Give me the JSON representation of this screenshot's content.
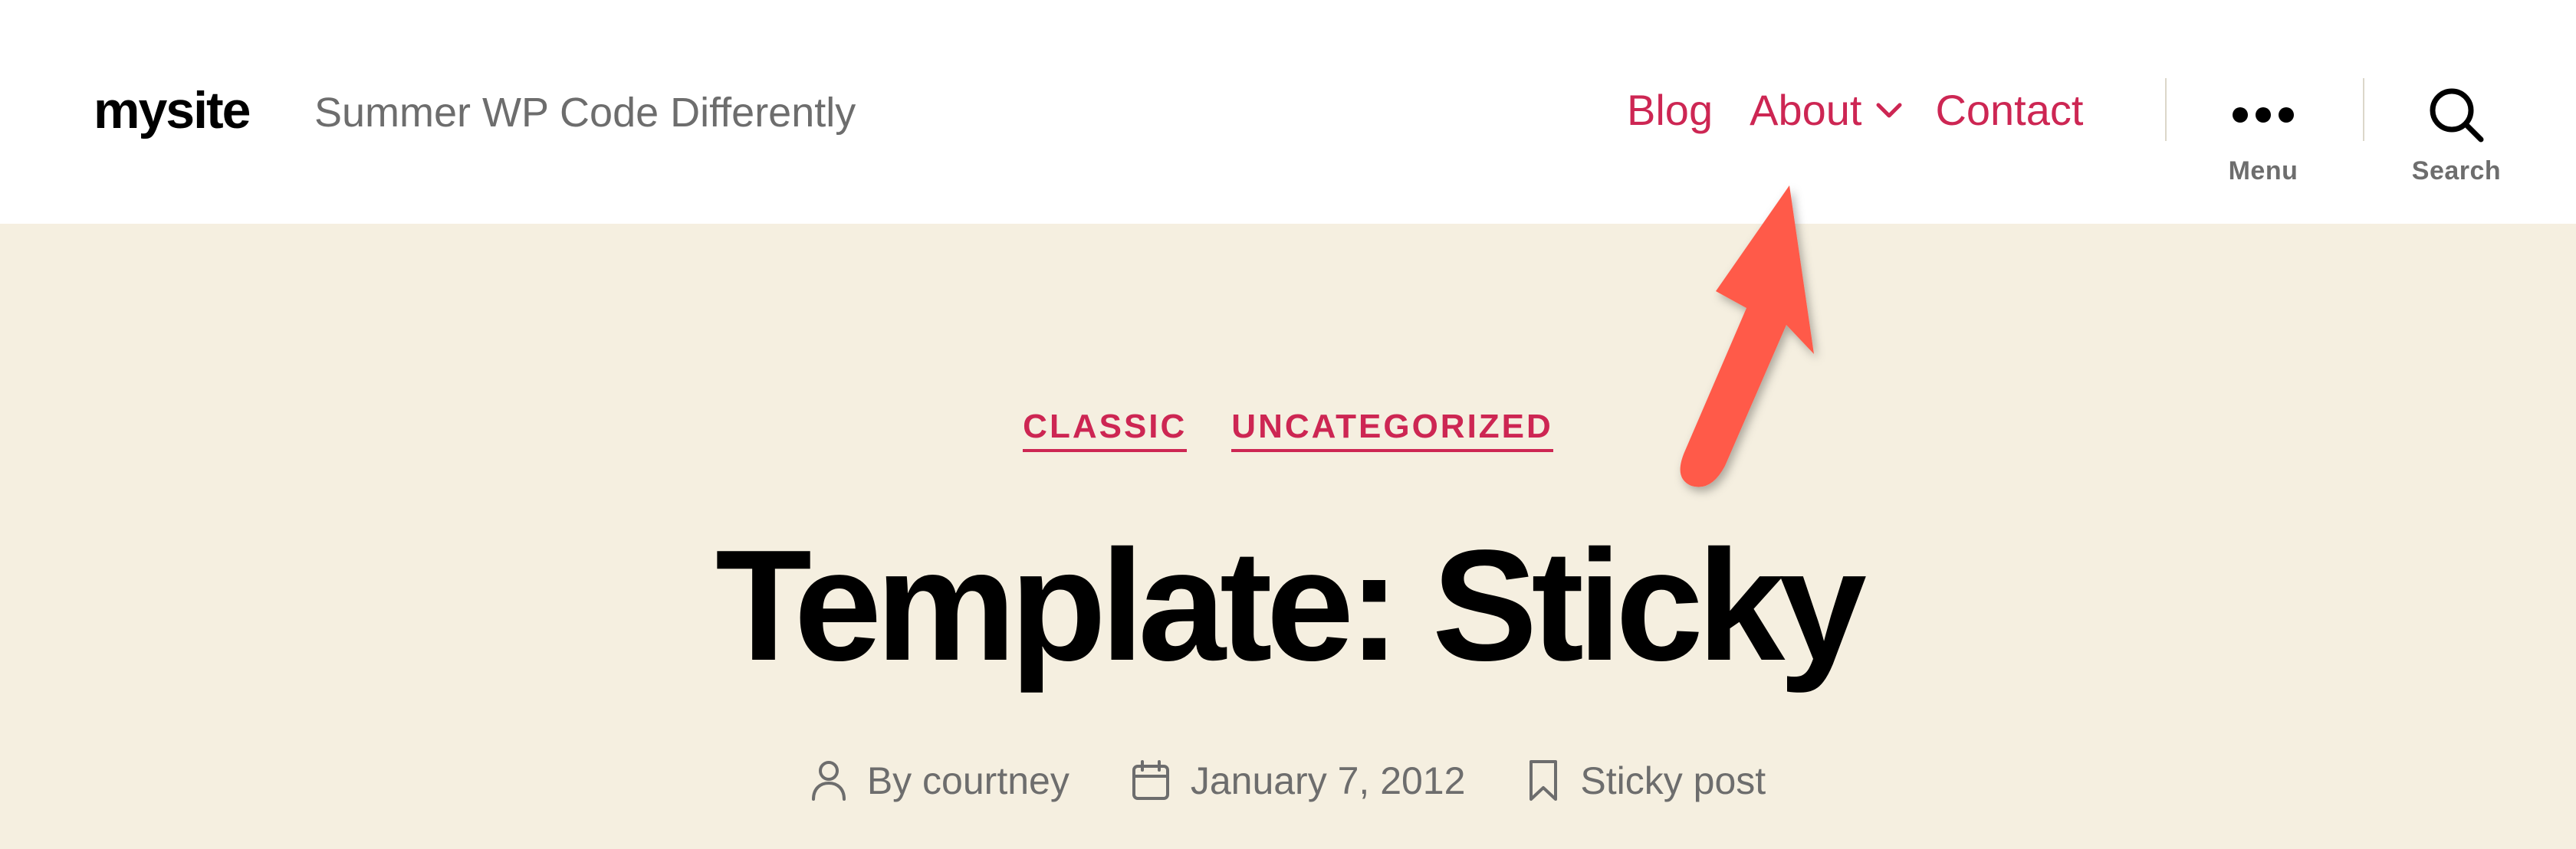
{
  "header": {
    "site_title": "mysite",
    "site_description": "Summer WP Code Differently",
    "nav": {
      "blog": "Blog",
      "about": "About",
      "contact": "Contact"
    },
    "menu_toggle_label": "Menu",
    "search_toggle_label": "Search"
  },
  "entry": {
    "categories": [
      "CLASSIC",
      "UNCATEGORIZED"
    ],
    "title": "Template: Sticky",
    "meta": {
      "author": "By courtney",
      "date": "January 7, 2012",
      "sticky": "Sticky post"
    }
  },
  "colors": {
    "accent": "#cd2653",
    "header_background": "#ffffff",
    "page_background": "#f5efe0",
    "secondary_text": "#6d6d6d",
    "annotation_arrow": "#ff5a4a"
  },
  "icons": {
    "about_dropdown": "chevron-down-icon",
    "menu": "ellipsis-icon",
    "search": "search-icon",
    "author": "user-icon",
    "date": "calendar-icon",
    "sticky": "bookmark-icon"
  }
}
